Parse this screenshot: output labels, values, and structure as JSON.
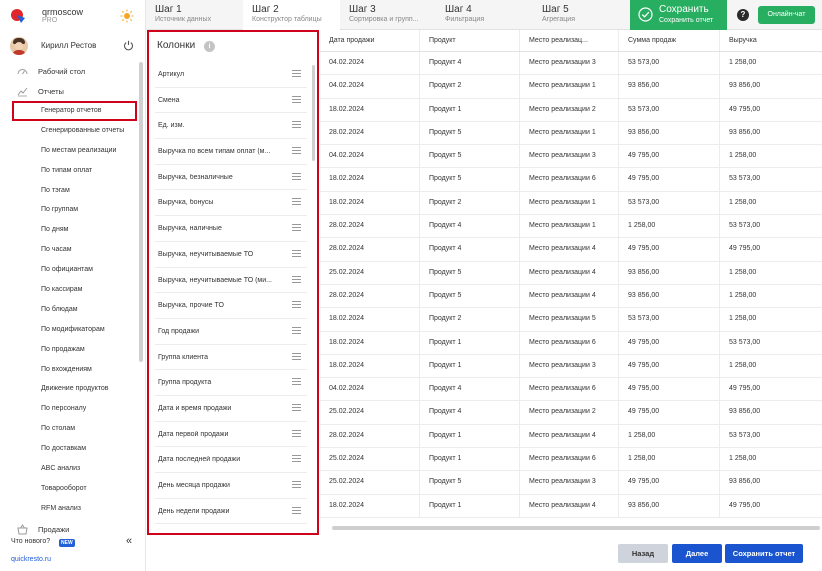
{
  "brand": {
    "name": "qrmoscow",
    "plan": "PRO"
  },
  "user": {
    "name": "Кирилл Рестов"
  },
  "nav": {
    "desktop": "Рабочий стол",
    "reports": "Отчеты",
    "sales": "Продажи"
  },
  "subnav": [
    "Генератор отчетов",
    "Сгенерированные отчеты",
    "По местам реализации",
    "По типам оплат",
    "По тэгам",
    "По группам",
    "По дням",
    "По часам",
    "По официантам",
    "По кассирам",
    "По блюдам",
    "По модификаторам",
    "По продажам",
    "По вхождениям",
    "Движение продуктов",
    "По персоналу",
    "По столам",
    "По доставкам",
    "ABC анализ",
    "Товарооборот",
    "RFM анализ"
  ],
  "footer": {
    "whats_new": "Что нового?",
    "new_badge": "NEW",
    "link": "quickresto.ru"
  },
  "steps": [
    {
      "title": "Шаг 1",
      "subtitle": "Источник данных"
    },
    {
      "title": "Шаг 2",
      "subtitle": "Конструктор таблицы"
    },
    {
      "title": "Шаг 3",
      "subtitle": "Сортировка и групп..."
    },
    {
      "title": "Шаг 4",
      "subtitle": "Фильтрация"
    },
    {
      "title": "Шаг 5",
      "subtitle": "Агрегация"
    }
  ],
  "save_header": {
    "title": "Сохранить",
    "subtitle": "Сохранить отчет"
  },
  "help_label": "?",
  "online_chat": "Онлайн-чат",
  "columns_panel": {
    "title": "Колонки",
    "info": "i",
    "items": [
      "Артикул",
      "Смена",
      "Ед. изм.",
      "Выручка по всем типам оплат (м...",
      "Выручка, безналичные",
      "Выручка, бонусы",
      "Выручка, наличные",
      "Выручка, неучитываемые ТО",
      "Выручка, неучитываемые ТО (ми...",
      "Выручка, прочие ТО",
      "Год продажи",
      "Группа клиента",
      "Группа продукта",
      "Дата и время продажи",
      "Дата первой продажи",
      "Дата последней продажи",
      "День месяца продажи",
      "День недели продажи"
    ]
  },
  "table": {
    "headers": [
      "Дата продажи",
      "Продукт",
      "Место реализац...",
      "Сумма продаж",
      "Выручка"
    ],
    "rows": [
      [
        "04.02.2024",
        "Продукт 4",
        "Место реализации 3",
        "53 573,00",
        "1 258,00"
      ],
      [
        "04.02.2024",
        "Продукт 2",
        "Место реализации 1",
        "93 856,00",
        "93 856,00"
      ],
      [
        "18.02.2024",
        "Продукт 1",
        "Место реализации 2",
        "53 573,00",
        "49 795,00"
      ],
      [
        "28.02.2024",
        "Продукт 5",
        "Место реализации 1",
        "93 856,00",
        "93 856,00"
      ],
      [
        "04.02.2024",
        "Продукт 5",
        "Место реализации 3",
        "49 795,00",
        "1 258,00"
      ],
      [
        "18.02.2024",
        "Продукт 5",
        "Место реализации 6",
        "49 795,00",
        "53 573,00"
      ],
      [
        "18.02.2024",
        "Продукт 2",
        "Место реализации 1",
        "53 573,00",
        "1 258,00"
      ],
      [
        "28.02.2024",
        "Продукт 4",
        "Место реализации 1",
        "1 258,00",
        "53 573,00"
      ],
      [
        "28.02.2024",
        "Продукт 4",
        "Место реализации 4",
        "49 795,00",
        "49 795,00"
      ],
      [
        "25.02.2024",
        "Продукт 5",
        "Место реализации 4",
        "93 856,00",
        "1 258,00"
      ],
      [
        "28.02.2024",
        "Продукт 5",
        "Место реализации 4",
        "93 856,00",
        "1 258,00"
      ],
      [
        "18.02.2024",
        "Продукт 2",
        "Место реализации 5",
        "53 573,00",
        "1 258,00"
      ],
      [
        "18.02.2024",
        "Продукт 1",
        "Место реализации 6",
        "49 795,00",
        "53 573,00"
      ],
      [
        "18.02.2024",
        "Продукт 1",
        "Место реализации 3",
        "49 795,00",
        "1 258,00"
      ],
      [
        "04.02.2024",
        "Продукт 4",
        "Место реализации 6",
        "49 795,00",
        "49 795,00"
      ],
      [
        "25.02.2024",
        "Продукт 4",
        "Место реализации 2",
        "49 795,00",
        "93 856,00"
      ],
      [
        "28.02.2024",
        "Продукт 1",
        "Место реализации 4",
        "1 258,00",
        "53 573,00"
      ],
      [
        "25.02.2024",
        "Продукт 1",
        "Место реализации 6",
        "1 258,00",
        "1 258,00"
      ],
      [
        "25.02.2024",
        "Продукт 5",
        "Место реализации 3",
        "49 795,00",
        "93 856,00"
      ],
      [
        "18.02.2024",
        "Продукт 1",
        "Место реализации 4",
        "93 856,00",
        "49 795,00"
      ]
    ]
  },
  "buttons": {
    "back": "Назад",
    "next": "Далее",
    "save": "Сохранить отчет"
  },
  "colors": {
    "accent_blue": "#1a55cf",
    "green": "#27ae60",
    "highlight_red": "#d0021b"
  }
}
